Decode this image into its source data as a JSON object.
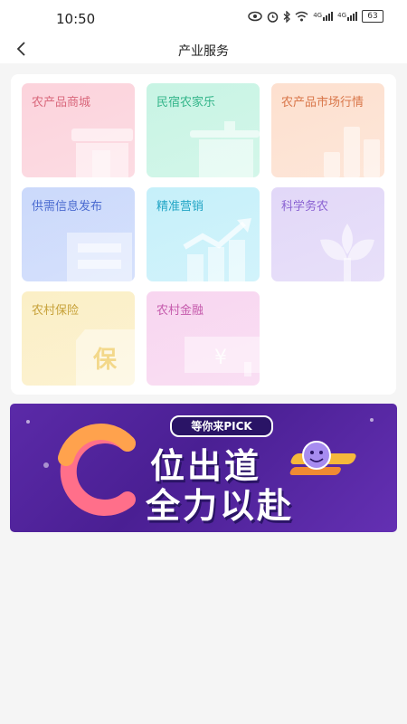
{
  "status_bar": {
    "time": "10:50",
    "icons": [
      "eye-icon",
      "alarm-icon",
      "bluetooth-icon",
      "wifi-icon",
      "signal-4g-icon",
      "signal-4g-icon"
    ],
    "signal_label_1": "4G",
    "signal_label_2": "4G",
    "battery": "63"
  },
  "nav": {
    "title": "产业服务",
    "back_icon": "chevron-left-icon"
  },
  "services": [
    {
      "label": "农产品商城",
      "icon": "shop-icon",
      "bg": "#fcd3dc",
      "text_color": "#d9687c"
    },
    {
      "label": "民宿农家乐",
      "icon": "pot-icon",
      "bg": "#c8f4e4",
      "text_color": "#34b58a"
    },
    {
      "label": "农产品市场行情",
      "icon": "bar-chart-icon",
      "bg": "#fde0cf",
      "text_color": "#d9774a"
    },
    {
      "label": "供需信息发布",
      "icon": "document-icon",
      "bg": "#cbd9fb",
      "text_color": "#4b6bd0"
    },
    {
      "label": "精准营销",
      "icon": "trend-chart-icon",
      "bg": "#c6f0fa",
      "text_color": "#23a5c5"
    },
    {
      "label": "科学务农",
      "icon": "sprout-icon",
      "bg": "#e2d8f8",
      "text_color": "#8a62d2"
    },
    {
      "label": "农村保险",
      "icon": "insurance-icon",
      "bg": "#fbefc6",
      "text_color": "#c7a23a"
    },
    {
      "label": "农村金融",
      "icon": "yuan-card-icon",
      "bg": "#f8d6f0",
      "text_color": "#c55aac"
    }
  ],
  "banner": {
    "tag": "等你来PICK",
    "line1": "位出道",
    "line2": "全力以赴",
    "accent_letter": "C",
    "accent_color": "#ff6f8a"
  }
}
